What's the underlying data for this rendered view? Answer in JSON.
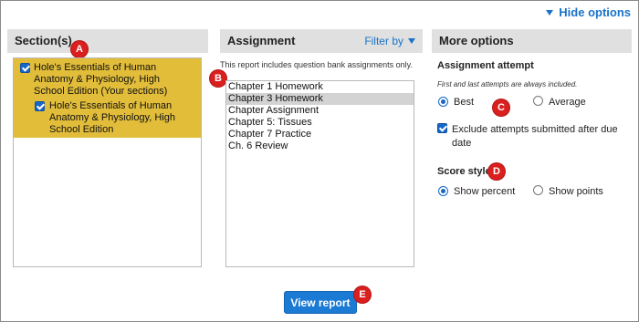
{
  "header": {
    "hide_options_label": "Hide options"
  },
  "sections": {
    "title": "Section(s)",
    "items": [
      {
        "label_lines": [
          "Hole's Essentials of Human",
          "Anatomy & Physiology, High",
          "School Edition  (Your sections)"
        ],
        "checked": true
      },
      {
        "label_lines": [
          "Hole's Essentials of Human",
          "Anatomy & Physiology, High",
          "School Edition"
        ],
        "checked": true
      }
    ]
  },
  "assignment": {
    "title": "Assignment",
    "filter_label": "Filter by",
    "note": "This report includes question bank assignments only.",
    "items": [
      "Chapter 1 Homework",
      "Chapter 3 Homework",
      "Chapter Assignment",
      "Chapter 5: Tissues",
      "Chapter 7 Practice",
      "Ch. 6 Review"
    ],
    "selected_index": 1
  },
  "more_options": {
    "title": "More options",
    "attempt_title": "Assignment attempt",
    "attempt_note": "First and last attempts are always included.",
    "attempt_best": "Best",
    "attempt_average": "Average",
    "exclude_line1": "Exclude attempts submitted after due",
    "exclude_line2": "date",
    "score_title": "Score style",
    "score_percent": "Show percent",
    "score_points": "Show points"
  },
  "badges": {
    "a": "A",
    "b": "B",
    "c": "C",
    "d": "D",
    "e": "E"
  },
  "footer": {
    "view_report_label": "View report"
  },
  "colors": {
    "accent": "#1a73c8",
    "selected_section": "#e2bd3a",
    "badge": "#d9201e",
    "header_bg": "#e0e0e0"
  }
}
